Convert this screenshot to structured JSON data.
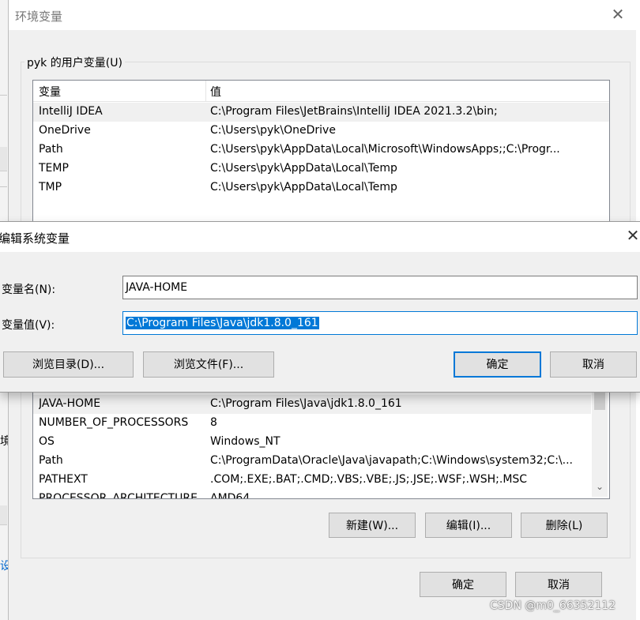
{
  "env_window": {
    "title": "环境变量",
    "close_glyph": "✕",
    "user_group_label": "pyk 的用户变量(U)",
    "columns": {
      "name": "变量",
      "value": "值"
    },
    "user_vars": [
      {
        "name": "IntelliJ IDEA",
        "value": "C:\\Program Files\\JetBrains\\IntelliJ IDEA 2021.3.2\\bin;"
      },
      {
        "name": "OneDrive",
        "value": "C:\\Users\\pyk\\OneDrive"
      },
      {
        "name": "Path",
        "value": "C:\\Users\\pyk\\AppData\\Local\\Microsoft\\WindowsApps;;C:\\Progr..."
      },
      {
        "name": "TEMP",
        "value": "C:\\Users\\pyk\\AppData\\Local\\Temp"
      },
      {
        "name": "TMP",
        "value": "C:\\Users\\pyk\\AppData\\Local\\Temp"
      }
    ],
    "system_vars": [
      {
        "name": "JAVA-HOME",
        "value": "C:\\Program Files\\Java\\jdk1.8.0_161"
      },
      {
        "name": "NUMBER_OF_PROCESSORS",
        "value": "8"
      },
      {
        "name": "OS",
        "value": "Windows_NT"
      },
      {
        "name": "Path",
        "value": "C:\\ProgramData\\Oracle\\Java\\javapath;C:\\Windows\\system32;C:\\..."
      },
      {
        "name": "PATHEXT",
        "value": ".COM;.EXE;.BAT;.CMD;.VBS;.VBE;.JS;.JSE;.WSF;.WSH;.MSC"
      },
      {
        "name": "PROCESSOR_ARCHITECTURE",
        "value": "AMD64"
      }
    ],
    "system_buttons": {
      "new": "新建(W)...",
      "edit": "编辑(I)...",
      "delete": "删除(L)"
    },
    "footer_buttons": {
      "ok": "确定",
      "cancel": "取消"
    }
  },
  "edit_dialog": {
    "title": "编辑系统变量",
    "close_glyph": "✕",
    "name_label": "变量名(N):",
    "name_value": "JAVA-HOME",
    "value_label": "变量值(V):",
    "value_value": "C:\\Program Files\\Java\\jdk1.8.0_161",
    "buttons": {
      "browse_dir": "浏览目录(D)...",
      "browse_file": "浏览文件(F)...",
      "ok": "确定",
      "cancel": "取消"
    }
  },
  "background": {
    "left_fragments": [
      "境",
      "设"
    ]
  },
  "watermark": "CSDN @m0_66352112",
  "colors": {
    "accent": "#0078d7",
    "selected_row": "#f0f0f0",
    "dialog_bg": "#f0f0f0"
  }
}
